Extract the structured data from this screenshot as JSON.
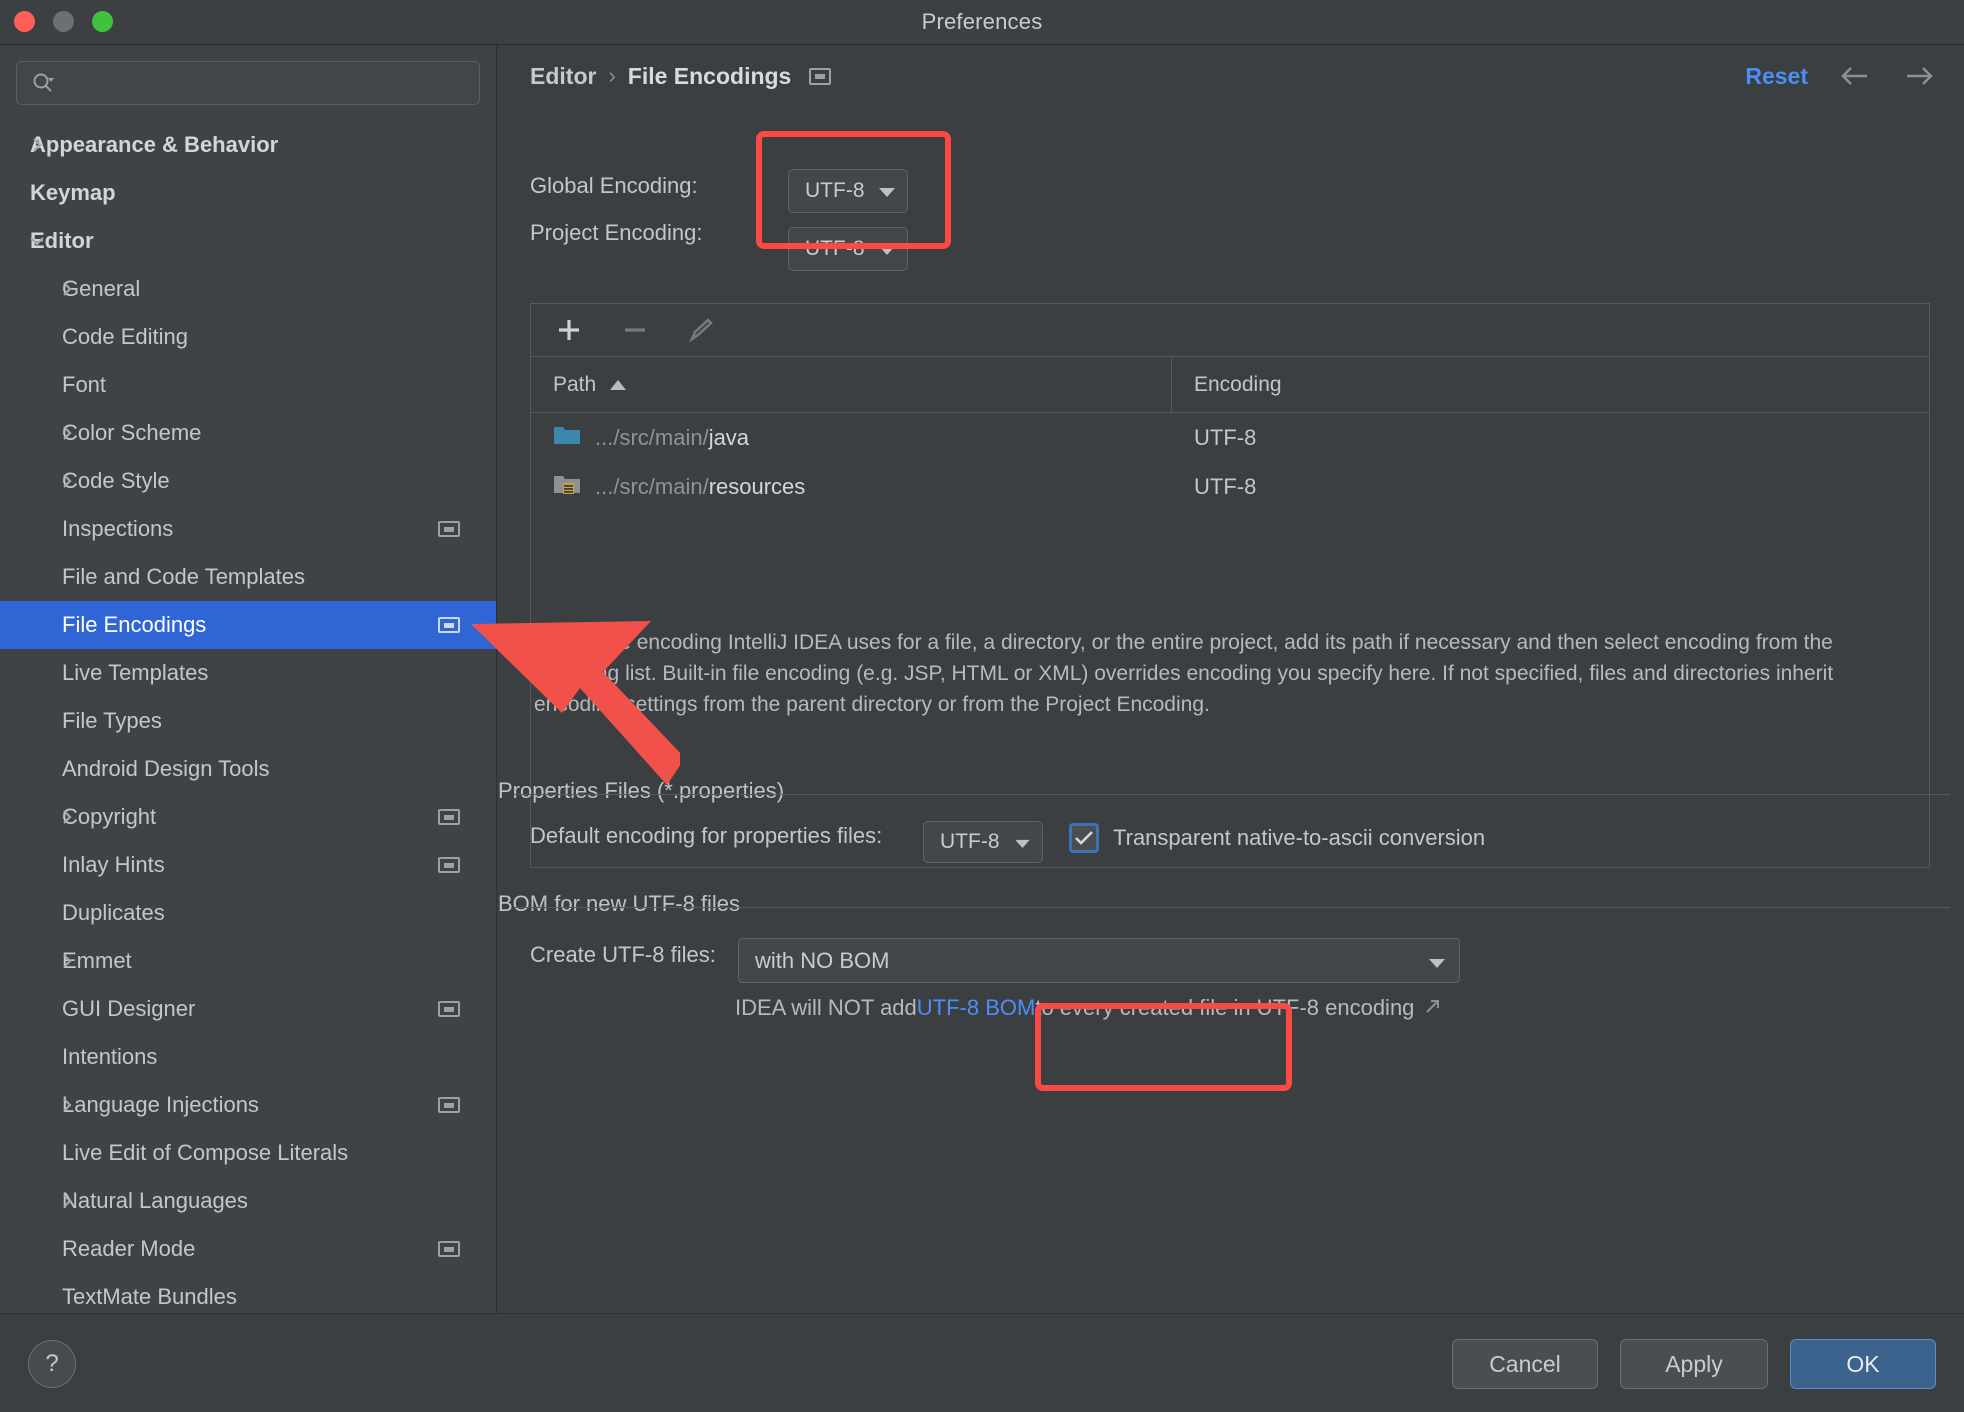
{
  "window": {
    "title": "Preferences",
    "controls": [
      "close",
      "minimize",
      "zoom"
    ]
  },
  "search": {
    "value": "",
    "placeholder": ""
  },
  "sidebar": {
    "items": [
      {
        "label": "Appearance & Behavior",
        "level": 1,
        "chevron": "right",
        "bold": true,
        "selected": false,
        "config_icon": false
      },
      {
        "label": "Keymap",
        "level": 1,
        "chevron": "none",
        "bold": true,
        "selected": false,
        "config_icon": false
      },
      {
        "label": "Editor",
        "level": 1,
        "chevron": "down",
        "bold": true,
        "selected": false,
        "config_icon": false
      },
      {
        "label": "General",
        "level": 2,
        "chevron": "right",
        "bold": false,
        "selected": false,
        "config_icon": false
      },
      {
        "label": "Code Editing",
        "level": 2,
        "chevron": "none",
        "bold": false,
        "selected": false,
        "config_icon": false
      },
      {
        "label": "Font",
        "level": 2,
        "chevron": "none",
        "bold": false,
        "selected": false,
        "config_icon": false
      },
      {
        "label": "Color Scheme",
        "level": 2,
        "chevron": "right",
        "bold": false,
        "selected": false,
        "config_icon": false
      },
      {
        "label": "Code Style",
        "level": 2,
        "chevron": "right",
        "bold": false,
        "selected": false,
        "config_icon": false
      },
      {
        "label": "Inspections",
        "level": 2,
        "chevron": "none",
        "bold": false,
        "selected": false,
        "config_icon": true
      },
      {
        "label": "File and Code Templates",
        "level": 2,
        "chevron": "none",
        "bold": false,
        "selected": false,
        "config_icon": false
      },
      {
        "label": "File Encodings",
        "level": 2,
        "chevron": "none",
        "bold": false,
        "selected": true,
        "config_icon": true
      },
      {
        "label": "Live Templates",
        "level": 2,
        "chevron": "none",
        "bold": false,
        "selected": false,
        "config_icon": false
      },
      {
        "label": "File Types",
        "level": 2,
        "chevron": "none",
        "bold": false,
        "selected": false,
        "config_icon": false
      },
      {
        "label": "Android Design Tools",
        "level": 2,
        "chevron": "none",
        "bold": false,
        "selected": false,
        "config_icon": false
      },
      {
        "label": "Copyright",
        "level": 2,
        "chevron": "right",
        "bold": false,
        "selected": false,
        "config_icon": true
      },
      {
        "label": "Inlay Hints",
        "level": 2,
        "chevron": "none",
        "bold": false,
        "selected": false,
        "config_icon": true
      },
      {
        "label": "Duplicates",
        "level": 2,
        "chevron": "none",
        "bold": false,
        "selected": false,
        "config_icon": false
      },
      {
        "label": "Emmet",
        "level": 2,
        "chevron": "right",
        "bold": false,
        "selected": false,
        "config_icon": false
      },
      {
        "label": "GUI Designer",
        "level": 2,
        "chevron": "none",
        "bold": false,
        "selected": false,
        "config_icon": true
      },
      {
        "label": "Intentions",
        "level": 2,
        "chevron": "none",
        "bold": false,
        "selected": false,
        "config_icon": false
      },
      {
        "label": "Language Injections",
        "level": 2,
        "chevron": "right",
        "bold": false,
        "selected": false,
        "config_icon": true
      },
      {
        "label": "Live Edit of Compose Literals",
        "level": 2,
        "chevron": "none",
        "bold": false,
        "selected": false,
        "config_icon": false
      },
      {
        "label": "Natural Languages",
        "level": 2,
        "chevron": "right",
        "bold": false,
        "selected": false,
        "config_icon": false
      },
      {
        "label": "Reader Mode",
        "level": 2,
        "chevron": "none",
        "bold": false,
        "selected": false,
        "config_icon": true
      },
      {
        "label": "TextMate Bundles",
        "level": 2,
        "chevron": "none",
        "bold": false,
        "selected": false,
        "config_icon": false
      }
    ]
  },
  "breadcrumb": {
    "parent": "Editor",
    "separator": "›",
    "current": "File Encodings"
  },
  "header": {
    "reset_label": "Reset",
    "back_icon": "arrow-left-icon",
    "forward_icon": "arrow-right-icon"
  },
  "encodings": {
    "global_label": "Global Encoding:",
    "global_value": "UTF-8",
    "project_label": "Project Encoding:",
    "project_value": "UTF-8"
  },
  "toolbar": {
    "add_icon": "plus-icon",
    "remove_icon": "minus-icon",
    "edit_icon": "pencil-icon"
  },
  "table": {
    "columns": [
      "Path",
      "Encoding"
    ],
    "sort_column": "Path",
    "sort_direction": "ascending",
    "rows": [
      {
        "icon": "folder-icon",
        "path_dim": ".../src/main/",
        "path_bright": "java",
        "encoding": "UTF-8"
      },
      {
        "icon": "resources-folder-icon",
        "path_dim": ".../src/main/",
        "path_bright": "resources",
        "encoding": "UTF-8"
      }
    ]
  },
  "description": "To change encoding IntelliJ IDEA uses for a file, a directory, or the entire project, add its path if necessary and then select encoding from the encoding list. Built-in file encoding (e.g. JSP, HTML or XML) overrides encoding you specify here. If not specified, files and directories inherit encoding settings from the parent directory or from the Project Encoding.",
  "properties_section": {
    "title": "Properties Files (*.properties)",
    "default_encoding_label": "Default encoding for properties files:",
    "default_encoding_value": "UTF-8",
    "transparent_checkbox_label": "Transparent native-to-ascii conversion",
    "transparent_checked": true
  },
  "bom_section": {
    "title": "BOM for new UTF-8 files",
    "create_label": "Create UTF-8 files:",
    "create_value": "with NO BOM",
    "note_prefix": "IDEA will NOT add ",
    "note_link": "UTF-8 BOM",
    "note_suffix": " to every created file in UTF-8 encoding",
    "external_link_icon": "external-link-icon"
  },
  "footer": {
    "help_label": "?",
    "cancel_label": "Cancel",
    "apply_label": "Apply",
    "ok_label": "OK"
  },
  "annotations": {
    "highlight_color": "#fb4a43",
    "arrow_color": "#f2514b",
    "boxes": [
      "encoding-dropdowns",
      "properties-default-encoding"
    ],
    "arrow_points_to": "File Encodings"
  },
  "colors": {
    "accent_blue": "#2f65d4",
    "link_blue": "#4d8df6",
    "window_bg": "#3c3f41",
    "sidebar_bg": "#3f4347",
    "primary_button": "#3c628e"
  }
}
